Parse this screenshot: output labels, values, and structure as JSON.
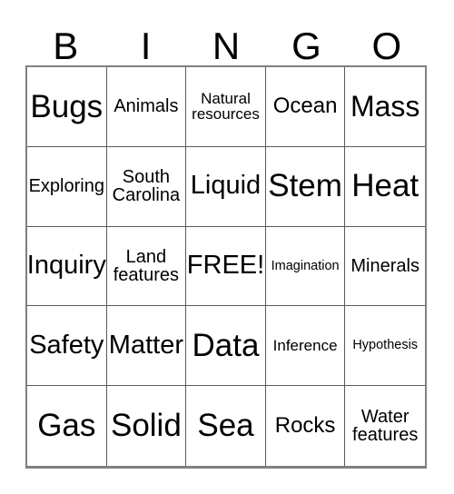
{
  "card": {
    "header_letters": [
      "B",
      "I",
      "N",
      "G",
      "O"
    ],
    "border_color": "#808080",
    "grid_line_color": "#595959",
    "background_color": "#ffffff",
    "text_color": "#000000",
    "rows": 5,
    "columns": 5,
    "cells": [
      {
        "text": "Bugs",
        "size": "fs-xxl",
        "free": false
      },
      {
        "text": "Animals",
        "size": "fs-sm",
        "free": false
      },
      {
        "text": "Natural\nresources",
        "size": "fs-xs",
        "free": false
      },
      {
        "text": "Ocean",
        "size": "fs-md",
        "free": false
      },
      {
        "text": "Mass",
        "size": "fs-xl",
        "free": false
      },
      {
        "text": "Exploring",
        "size": "fs-sm",
        "free": false
      },
      {
        "text": "South\nCarolina",
        "size": "fs-sm",
        "free": false
      },
      {
        "text": "Liquid",
        "size": "fs-lg",
        "free": false
      },
      {
        "text": "Stem",
        "size": "fs-xxl",
        "free": false
      },
      {
        "text": "Heat",
        "size": "fs-xxl",
        "free": false
      },
      {
        "text": "Inquiry",
        "size": "fs-lg",
        "free": false
      },
      {
        "text": "Land\nfeatures",
        "size": "fs-sm",
        "free": false
      },
      {
        "text": "FREE!",
        "size": "fs-lg",
        "free": true
      },
      {
        "text": "Imagination",
        "size": "fs-xxs",
        "free": false
      },
      {
        "text": "Minerals",
        "size": "fs-sm",
        "free": false
      },
      {
        "text": "Safety",
        "size": "fs-lg",
        "free": false
      },
      {
        "text": "Matter",
        "size": "fs-lg",
        "free": false
      },
      {
        "text": "Data",
        "size": "fs-xxl",
        "free": false
      },
      {
        "text": "Inference",
        "size": "fs-xs",
        "free": false
      },
      {
        "text": "Hypothesis",
        "size": "fs-xxs",
        "free": false
      },
      {
        "text": "Gas",
        "size": "fs-xxl",
        "free": false
      },
      {
        "text": "Solid",
        "size": "fs-xxl",
        "free": false
      },
      {
        "text": "Sea",
        "size": "fs-xxl",
        "free": false
      },
      {
        "text": "Rocks",
        "size": "fs-md",
        "free": false
      },
      {
        "text": "Water\nfeatures",
        "size": "fs-sm",
        "free": false
      }
    ]
  }
}
